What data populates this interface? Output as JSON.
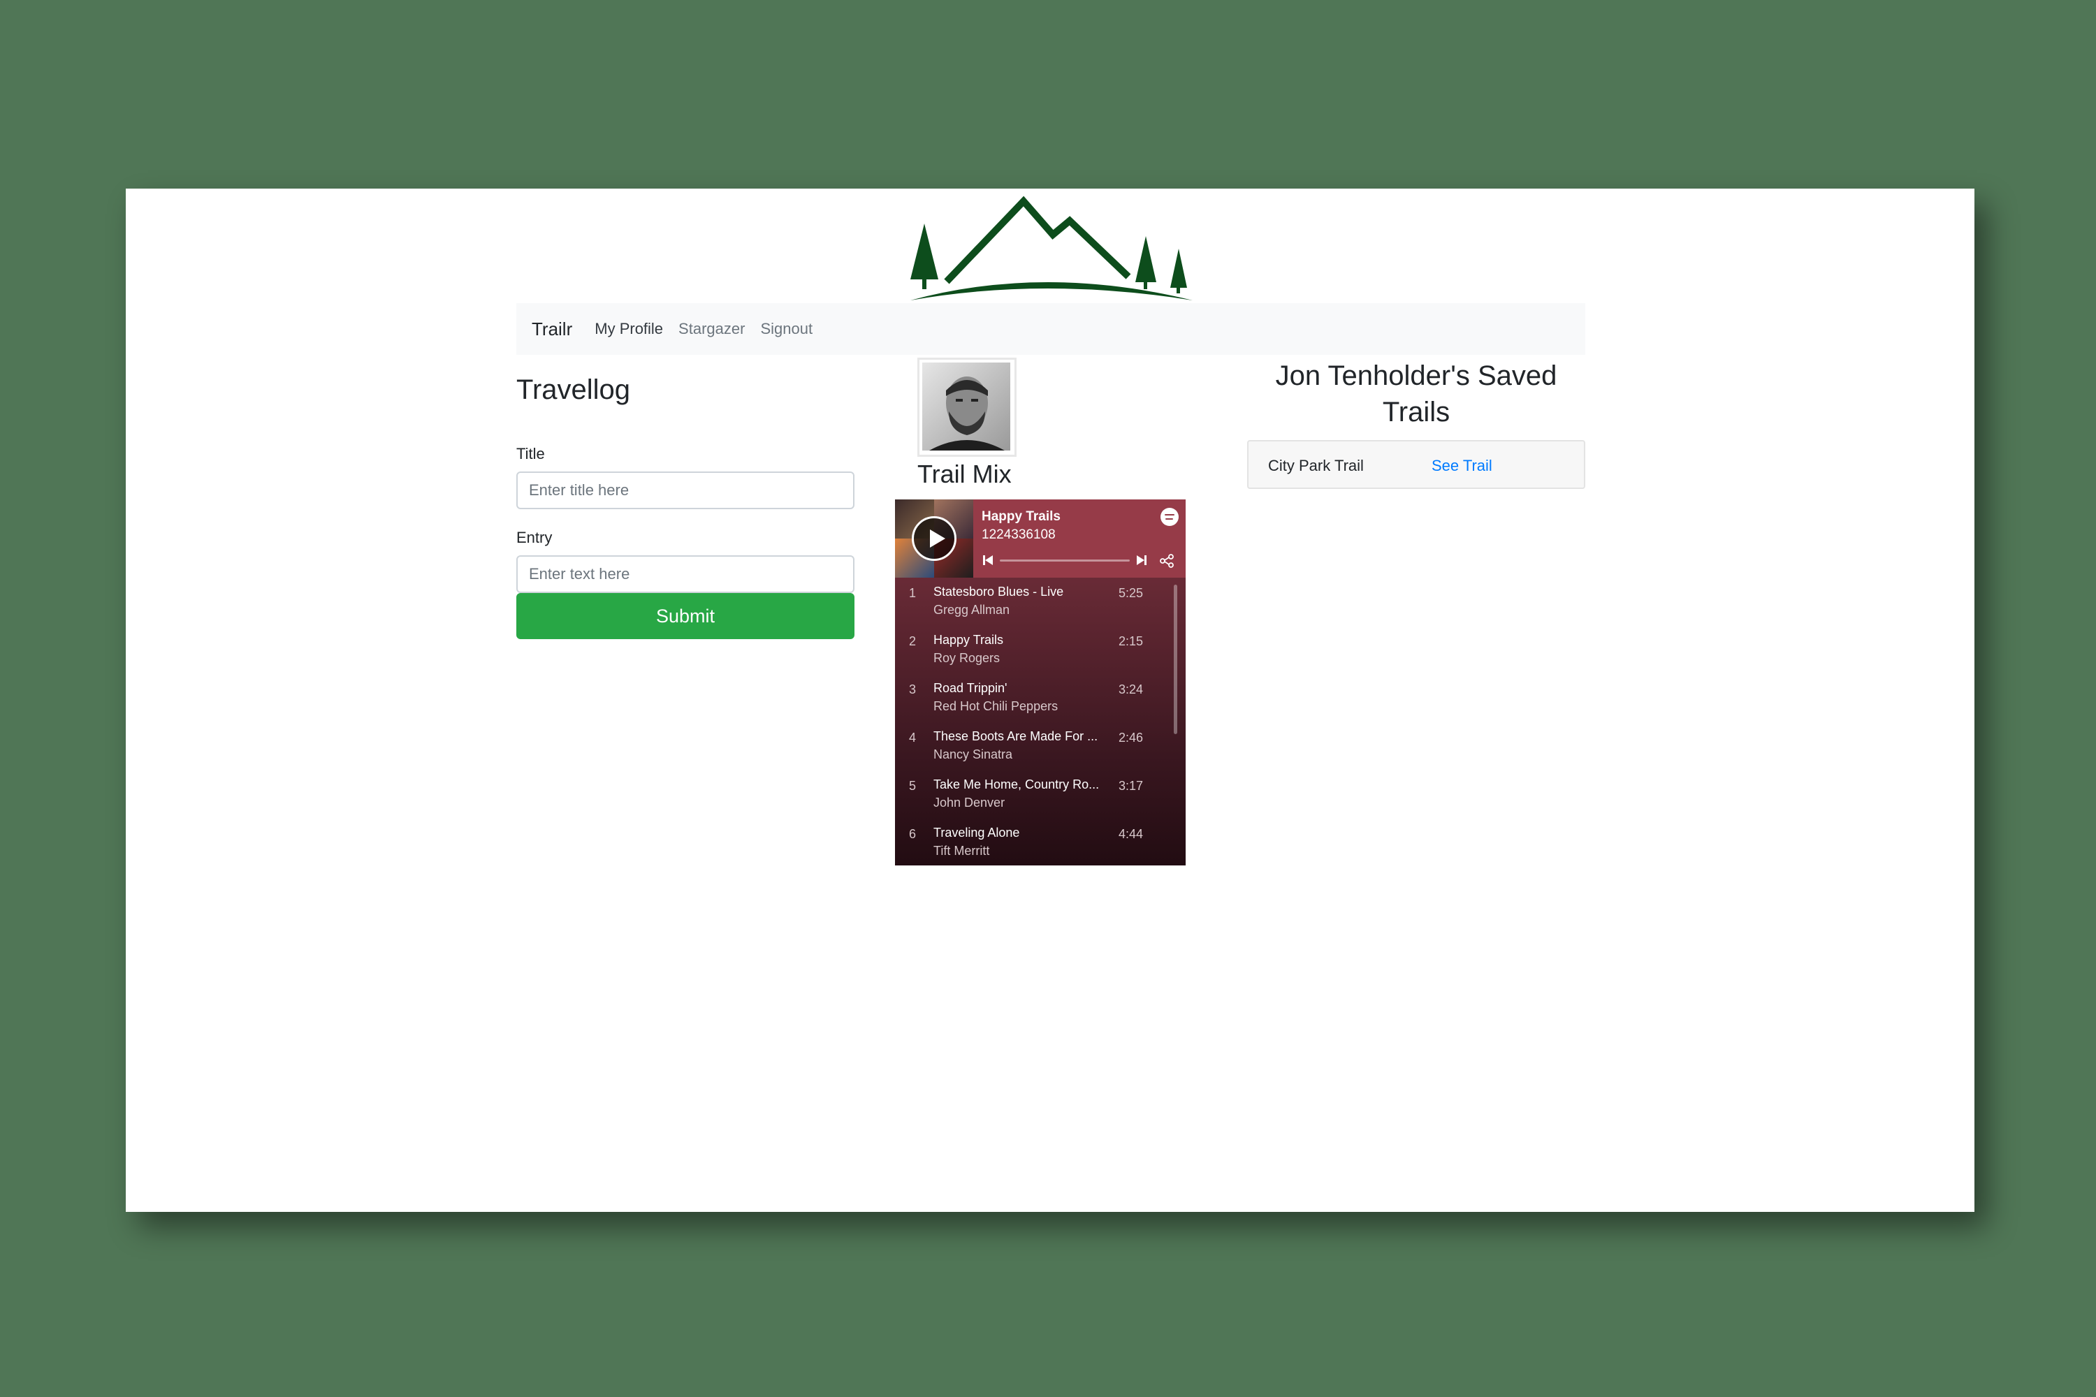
{
  "navbar": {
    "brand": "Trailr",
    "links": [
      "My Profile",
      "Stargazer",
      "Signout"
    ]
  },
  "travellog": {
    "heading": "Travellog",
    "title_label": "Title",
    "title_placeholder": "Enter title here",
    "entry_label": "Entry",
    "entry_placeholder": "Enter text here",
    "submit_label": "Submit"
  },
  "trailmix": {
    "heading": "Trail Mix",
    "player": {
      "playlist_title": "Happy Trails",
      "playlist_id": "1224336108",
      "tracks": [
        {
          "num": "1",
          "name": "Statesboro Blues - Live",
          "artist": "Gregg Allman",
          "duration": "5:25"
        },
        {
          "num": "2",
          "name": "Happy Trails",
          "artist": "Roy Rogers",
          "duration": "2:15"
        },
        {
          "num": "3",
          "name": "Road Trippin'",
          "artist": "Red Hot Chili Peppers",
          "duration": "3:24"
        },
        {
          "num": "4",
          "name": "These Boots Are Made For ...",
          "artist": "Nancy Sinatra",
          "duration": "2:46"
        },
        {
          "num": "5",
          "name": "Take Me Home, Country Ro...",
          "artist": "John Denver",
          "duration": "3:17"
        },
        {
          "num": "6",
          "name": "Traveling Alone",
          "artist": "Tift Merritt",
          "duration": "4:44"
        }
      ]
    }
  },
  "saved_trails": {
    "heading": "Jon Tenholder's Saved Trails",
    "items": [
      {
        "name": "City Park Trail",
        "link_label": "See Trail"
      }
    ]
  },
  "colors": {
    "background": "#507656",
    "logo_green": "#0d4d1c",
    "submit_green": "#28a745",
    "link_blue": "#007bff",
    "player_header": "#963b48"
  },
  "icons": [
    "mountain-logo",
    "play-icon",
    "spotify-icon",
    "previous-icon",
    "next-icon",
    "share-icon"
  ]
}
